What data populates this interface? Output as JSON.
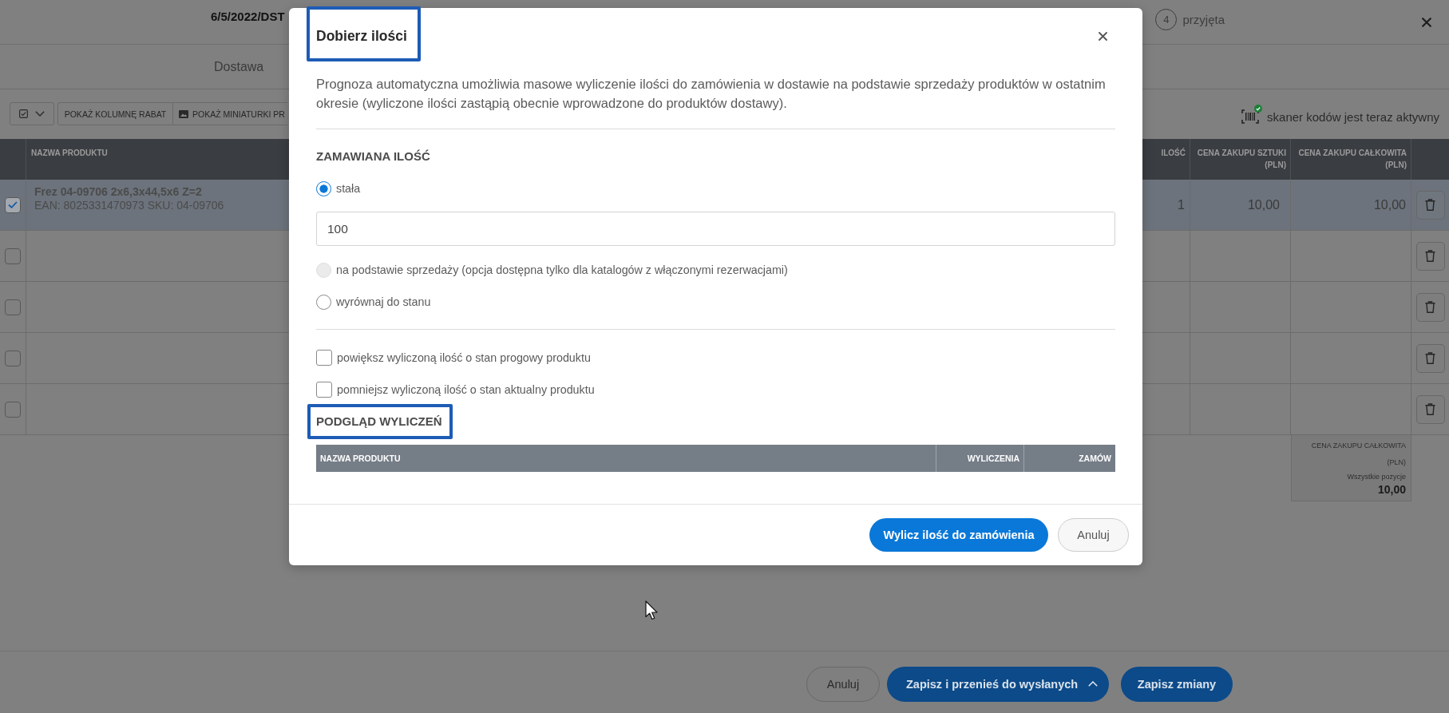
{
  "header": {
    "title": "6/5/2022/DST",
    "step": {
      "number": "4",
      "label": "przyjęta"
    }
  },
  "tab": {
    "label": "Dostawa"
  },
  "toolbar": {
    "buttons": [
      {
        "kind": "select-menu"
      },
      {
        "kind": "text",
        "label": "POKAŻ KOLUMNĘ RABAT"
      },
      {
        "kind": "image",
        "label": "POKAŻ MINIATURKI PR"
      }
    ],
    "scanner_status": "skaner kodów jest teraz aktywny"
  },
  "table": {
    "columns": [
      "NAZWA PRODUKTU",
      "ILOŚĆ",
      "CENA ZAKUPU SZTUKI\n(PLN)",
      "CENA ZAKUPU CAŁKOWITA\n(PLN)"
    ],
    "rows": [
      {
        "selected": true,
        "name": "Frez 04-09706 2x6,3x44,5x6 Z=2",
        "codes": "EAN: 8025331470973 SKU: 04-09706",
        "quantity": "1",
        "unit_price": "10,00",
        "total": "10,00"
      },
      {
        "selected": false
      },
      {
        "selected": false
      },
      {
        "selected": false
      },
      {
        "selected": false
      }
    ]
  },
  "summary": {
    "label": "CENA ZAKUPU CAŁKOWITA\n(PLN)",
    "scope": "Wszystkie pozycje",
    "value": "10,00"
  },
  "actions": [
    {
      "kind": "secondary",
      "label": "Anuluj"
    },
    {
      "kind": "split",
      "label": "Zapisz i przenieś do wysłanych"
    },
    {
      "kind": "primary",
      "label": "Zapisz zmiany"
    }
  ],
  "modal": {
    "title": "Dobierz ilości",
    "title_highlighted": true,
    "description": "Prognoza automatyczna umożliwia masowe wyliczenie ilości do zamówienia w dostawie na podstawie sprzedaży produktów w ostatnim okresie (wyliczone ilości zastąpią obecnie wprowadzone do produktów dostawy).",
    "quantity": {
      "heading": "ZAMAWIANA ILOŚĆ",
      "options": [
        {
          "label": "stała",
          "selected": true,
          "disabled": false,
          "value": "100"
        },
        {
          "label": "na podstawie sprzedaży (opcja dostępna tylko dla katalogów z włączonymi rezerwacjami)",
          "selected": false,
          "disabled": true
        },
        {
          "label": "wyrównaj do stanu",
          "selected": false,
          "disabled": false
        }
      ]
    },
    "adjustments": [
      {
        "label": "powiększ wyliczoną ilość o stan progowy produktu",
        "checked": false
      },
      {
        "label": "pomniejsz wyliczoną ilość o stan aktualny produktu",
        "checked": false
      }
    ],
    "preview": {
      "heading": "PODGLĄD WYLICZEŃ",
      "highlighted": true,
      "columns": [
        "NAZWA PRODUKTU",
        "WYLICZENIA",
        "ZAMÓW"
      ]
    },
    "buttons": [
      {
        "kind": "primary",
        "label": "Wylicz ilość do zamówienia"
      },
      {
        "kind": "secondary",
        "label": "Anuluj"
      }
    ]
  }
}
